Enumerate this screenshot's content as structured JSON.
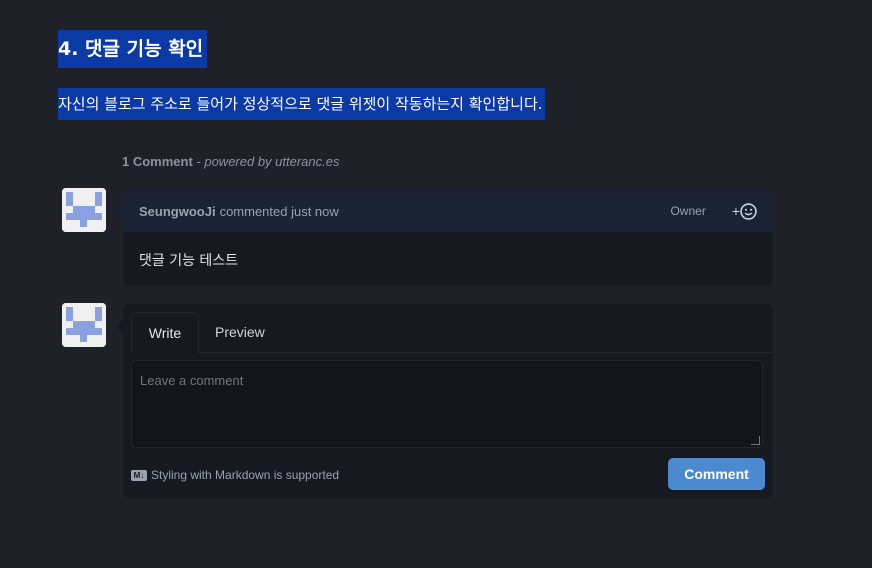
{
  "heading": "4. 댓글 기능 확인",
  "paragraph": "자신의 블로그 주소로 들어가 정상적으로 댓글 위젯이 작동하는지 확인합니다.",
  "comments_meta": {
    "count": "1 Comment",
    "powered": " - powered by utteranc.es"
  },
  "comment": {
    "author": "SeungwooJi",
    "action": "commented just now",
    "badge": "Owner",
    "reaction_plus": "+",
    "body": "댓글 기능 테스트"
  },
  "editor": {
    "tab_write": "Write",
    "tab_preview": "Preview",
    "placeholder": "Leave a comment",
    "markdown_note": "Styling with Markdown is supported",
    "submit": "Comment"
  },
  "colors": {
    "background": "#1f2129",
    "selection": "#0b3aa6",
    "button": "#4b8acf"
  },
  "icons": [
    "avatar-identicon",
    "smiley-icon",
    "markdown-icon"
  ]
}
